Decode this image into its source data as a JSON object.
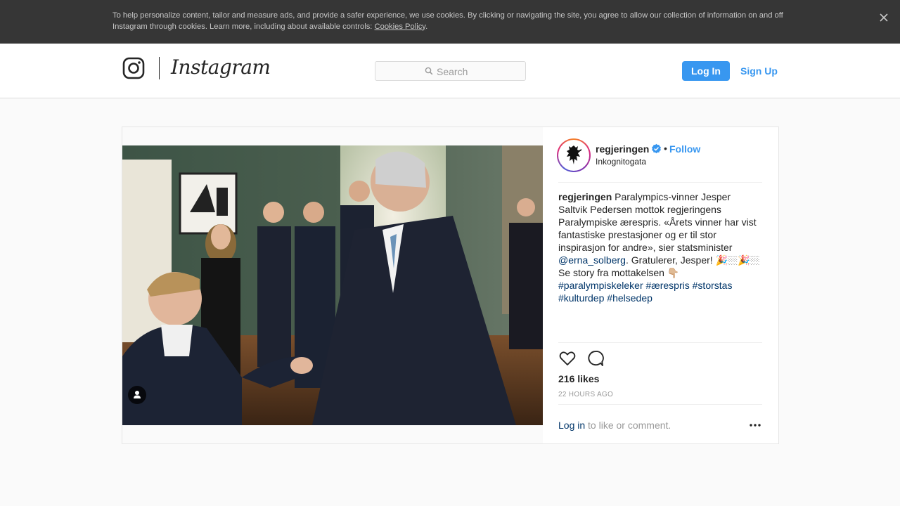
{
  "cookie_banner": {
    "text": "To help personalize content, tailor and measure ads, and provide a safer experience, we use cookies. By clicking or navigating the site, you agree to allow our collection of information on and off Instagram through cookies. Learn more, including about available controls: ",
    "link_text": "Cookies Policy",
    "trailing": ".",
    "close_icon": "close-icon"
  },
  "header": {
    "wordmark": "Instagram",
    "search_placeholder": "Search",
    "login_label": "Log In",
    "signup_label": "Sign Up"
  },
  "post": {
    "username": "regjeringen",
    "follow_label": "Follow",
    "separator": "•",
    "location": "Inkognitogata",
    "caption": {
      "username": "regjeringen",
      "text_before_mention": " Paralympics-vinner Jesper Saltvik Pedersen mottok regjeringens Paralympiske ærespris. «Årets vinner har vist fantastiske prestasjoner og er til stor inspirasjon for andre», sier statsminister ",
      "mention": "@erna_solberg",
      "text_after_mention": ". Gratulerer, Jesper! 🎉🏼🎉🏼 Se story fra mottakelsen 👇🏼",
      "hashtags": [
        "#paralympiskeleker",
        "#ærespris",
        "#storstas",
        "#kulturdep",
        "#helsedep"
      ]
    },
    "likes": "216 likes",
    "timestamp": "22 HOURS AGO",
    "login_prompt_link": "Log in",
    "login_prompt_text": " to like or comment."
  },
  "colors": {
    "accent": "#3897f0",
    "link_dark": "#003569",
    "banner_bg": "#363636"
  }
}
